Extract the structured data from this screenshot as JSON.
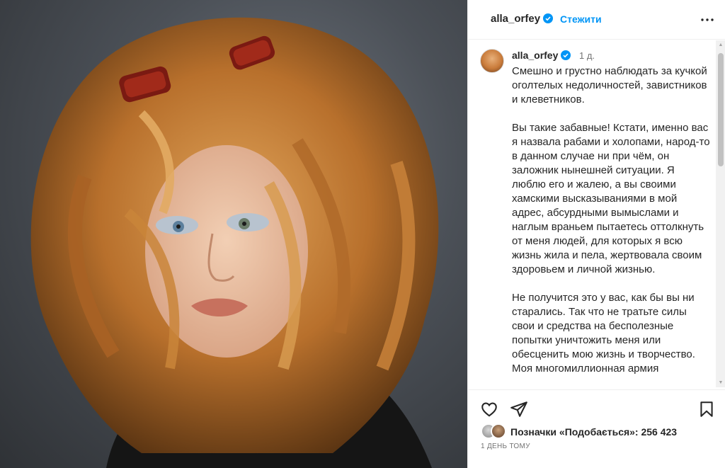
{
  "photo": {
    "alt_semantic": "portrait-photo"
  },
  "header": {
    "username": "alla_orfey",
    "separator": "•",
    "follow_label": "Стежити"
  },
  "caption": {
    "username": "alla_orfey",
    "time": "1 д.",
    "paragraphs": [
      "Смешно и грустно наблюдать за кучкой оголтелых недоличностей, завистников и клеветников.",
      "Вы такие забавные! Кстати, именно вас я назвала рабами и холопами, народ-то в данном случае ни при чём, он заложник нынешней ситуации. Я люблю его и жалею, а вы своими хамскими высказываниями в мой адрес, абсурдными вымыслами и наглым враньем пытаетесь оттолкнуть от меня людей, для которых я всю жизнь жила и пела, жертвовала своим здоровьем и личной жизнью.",
      "Не получится это у вас, как бы вы ни старались. Так что не тратьте силы свои и средства на бесполезные попытки уничтожить меня или обесценить мою жизнь и творчество. Моя многомиллионная армия"
    ]
  },
  "likes": {
    "label": "Позначки «Подобається»: 256 423"
  },
  "posted": {
    "label": "1 ДЕНЬ ТОМУ"
  },
  "colors": {
    "link": "#0095f6",
    "text": "#262626",
    "muted": "#737373",
    "border": "#efefef"
  }
}
